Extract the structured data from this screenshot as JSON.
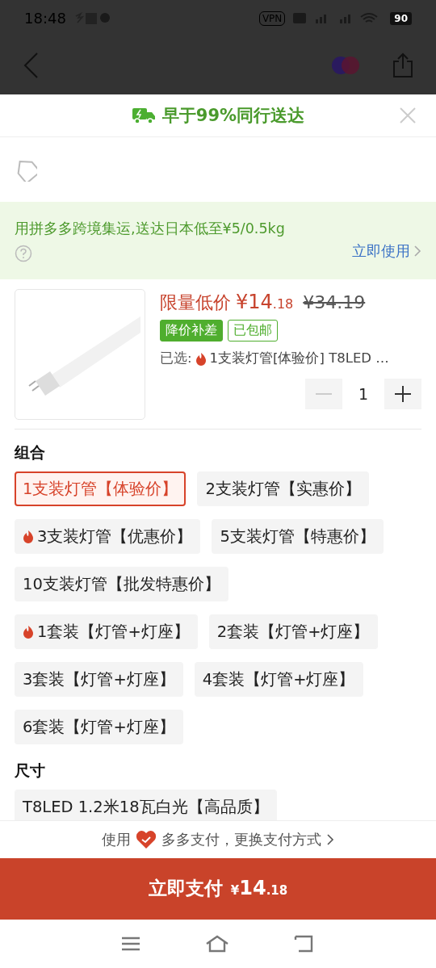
{
  "status_bar": {
    "time": "18:48",
    "vpn": "VPN",
    "battery": "90"
  },
  "delivery_banner": {
    "text": "早于99%同行送达"
  },
  "shipping_promo": {
    "text": "用拼多多跨境集运,送达日本低至¥5/0.5kg",
    "link": "立即使用"
  },
  "product": {
    "price_label": "限量低价",
    "price_main": "¥14",
    "price_decimal": ".18",
    "original_price": "¥34.19",
    "tags": [
      {
        "text": "降价补差",
        "kind": "filled"
      },
      {
        "text": "已包邮",
        "kind": "outline"
      }
    ],
    "selected_label": "已选:",
    "selected_text": "1支装灯管[体验价] T8LED …",
    "quantity": "1"
  },
  "sections": [
    {
      "title": "组合",
      "options": [
        {
          "text": "1支装灯管【体验价】",
          "hot": false,
          "selected": true
        },
        {
          "text": "2支装灯管【实惠价】",
          "hot": false,
          "selected": false
        },
        {
          "text": "3支装灯管【优惠价】",
          "hot": true,
          "selected": false
        },
        {
          "text": "5支装灯管【特惠价】",
          "hot": false,
          "selected": false
        },
        {
          "text": "10支装灯管【批发特惠价】",
          "hot": false,
          "selected": false
        },
        {
          "text": "1套装【灯管+灯座】",
          "hot": true,
          "selected": false
        },
        {
          "text": "2套装【灯管+灯座】",
          "hot": false,
          "selected": false
        },
        {
          "text": "3套装【灯管+灯座】",
          "hot": false,
          "selected": false
        },
        {
          "text": "4套装【灯管+灯座】",
          "hot": false,
          "selected": false
        },
        {
          "text": "6套装【灯管+灯座】",
          "hot": false,
          "selected": false
        }
      ]
    },
    {
      "title": "尺寸",
      "options": [
        {
          "text": "T8LED 1.2米18瓦白光【高品质】",
          "hot": false,
          "selected": false
        }
      ]
    }
  ],
  "payment": {
    "prefix": "使用",
    "method": "多多支付，更换支付方式"
  },
  "pay_button": {
    "label": "立即支付",
    "currency": "¥",
    "amount": "14",
    "decimal": ".18"
  }
}
